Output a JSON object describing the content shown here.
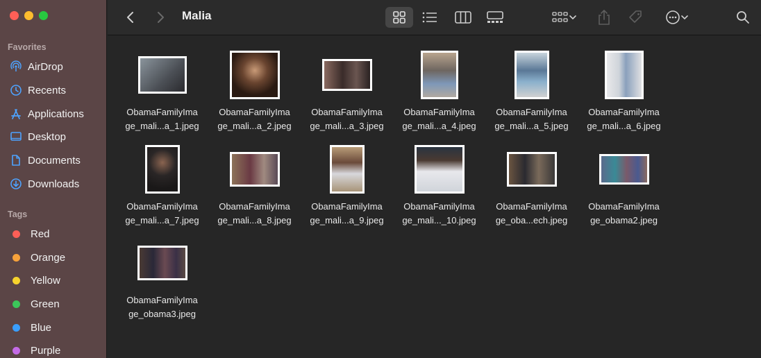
{
  "window": {
    "title": "Malia"
  },
  "sidebar": {
    "favorites_title": "Favorites",
    "favorites": [
      {
        "label": "AirDrop",
        "icon": "airdrop-icon"
      },
      {
        "label": "Recents",
        "icon": "clock-icon"
      },
      {
        "label": "Applications",
        "icon": "applications-icon"
      },
      {
        "label": "Desktop",
        "icon": "desktop-icon"
      },
      {
        "label": "Documents",
        "icon": "document-icon"
      },
      {
        "label": "Downloads",
        "icon": "download-icon"
      }
    ],
    "tags_title": "Tags",
    "tags": [
      {
        "label": "Red",
        "color": "#fe5f57"
      },
      {
        "label": "Orange",
        "color": "#f7a23b"
      },
      {
        "label": "Yellow",
        "color": "#f6d32d"
      },
      {
        "label": "Green",
        "color": "#3cc75a"
      },
      {
        "label": "Blue",
        "color": "#3a9efd"
      },
      {
        "label": "Purple",
        "color": "#c46be6"
      }
    ]
  },
  "toolbar": {
    "view_mode": "icons",
    "buttons": [
      "back-icon",
      "forward-icon",
      "icon-view-icon",
      "list-view-icon",
      "column-view-icon",
      "gallery-view-icon",
      "group-icon",
      "share-icon",
      "tag-icon",
      "more-icon",
      "search-icon"
    ]
  },
  "files": [
    {
      "line1": "ObamaFamilyIma",
      "line2": "ge_mali...a_1.jpeg",
      "thumb": "#7a8590"
    },
    {
      "line1": "ObamaFamilyIma",
      "line2": "ge_mali...a_2.jpeg",
      "thumb": "#4a3226"
    },
    {
      "line1": "ObamaFamilyIma",
      "line2": "ge_mali...a_3.jpeg",
      "thumb": "#5a4a48"
    },
    {
      "line1": "ObamaFamilyIma",
      "line2": "ge_mali...a_4.jpeg",
      "thumb": "#9aa0a8"
    },
    {
      "line1": "ObamaFamilyIma",
      "line2": "ge_mali...a_5.jpeg",
      "thumb": "#a7b4c0"
    },
    {
      "line1": "ObamaFamilyIma",
      "line2": "ge_mali...a_6.jpeg",
      "thumb": "#c9ccd0"
    },
    {
      "line1": "ObamaFamilyIma",
      "line2": "ge_mali...a_7.jpeg",
      "thumb": "#3c3a3a"
    },
    {
      "line1": "ObamaFamilyIma",
      "line2": "ge_mali...a_8.jpeg",
      "thumb": "#6b5558"
    },
    {
      "line1": "ObamaFamilyIma",
      "line2": "ge_mali...a_9.jpeg",
      "thumb": "#8a7a66"
    },
    {
      "line1": "ObamaFamilyIma",
      "line2": "ge_mali..._10.jpeg",
      "thumb": "#d8d8dc"
    },
    {
      "line1": "ObamaFamilyIma",
      "line2": "ge_oba...ech.jpeg",
      "thumb": "#4a4038"
    },
    {
      "line1": "ObamaFamilyIma",
      "line2": "ge_obama2.jpeg",
      "thumb": "#6e6880"
    },
    {
      "line1": "ObamaFamilyIma",
      "line2": "ge_obama3.jpeg",
      "thumb": "#5a4e4a"
    }
  ]
}
